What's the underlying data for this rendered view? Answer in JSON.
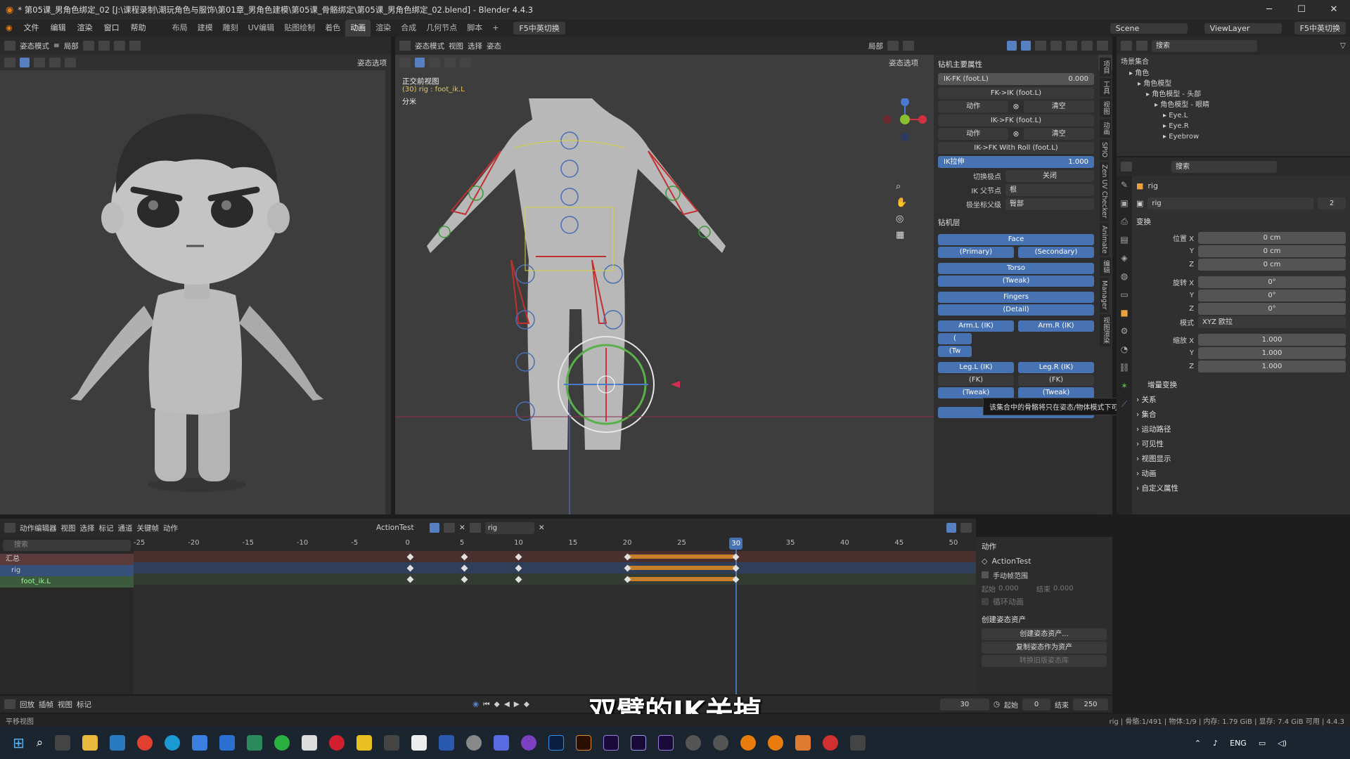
{
  "window": {
    "title": "* 第05课_男角色绑定_02 [J:\\课程录制\\潮玩角色与服饰\\第01章_男角色建模\\第05课_骨骼绑定\\第05课_男角色绑定_02.blend] - Blender 4.4.3"
  },
  "menu": {
    "items": [
      "文件",
      "编辑",
      "渲染",
      "窗口",
      "帮助"
    ],
    "workspaces": [
      "布局",
      "建模",
      "雕刻",
      "UV编辑",
      "贴图绘制",
      "着色",
      "动画",
      "渲染",
      "合成",
      "几何节点",
      "脚本"
    ],
    "active_workspace": "动画",
    "ime": "F5中英切换",
    "scene": "Scene",
    "view_layer": "ViewLayer",
    "ime2": "F5中英切换"
  },
  "left_vp": {
    "mode": "姿态模式",
    "view": "视图",
    "local": "局部",
    "pose_opts": "姿态选项"
  },
  "main_vp": {
    "mode": "姿态模式",
    "menus": [
      "视图",
      "选择",
      "姿态"
    ],
    "local": "局部",
    "pose_opts": "姿态选项",
    "overlay_title": "正交前视图",
    "overlay_sub": "(30) rig : foot_ik.L",
    "overlay_unit": "分米"
  },
  "rig_panel": {
    "main_props": "钻机主要属性",
    "ikfk_label": "IK-FK (foot.L)",
    "ikfk_value": "0.000",
    "fk_to_ik": "FK->IK (foot.L)",
    "action": "动作",
    "clear": "清空",
    "ik_to_fk": "IK->FK (foot.L)",
    "action2": "动作",
    "clear2": "清空",
    "ik_fk_roll": "IK->FK With Roll (foot.L)",
    "ik_stretch": "IK拉伸",
    "ik_stretch_value": "1.000",
    "toggle_pole": "切换极点",
    "toggle_pole_value": "关闭",
    "ik_parent": "IK 父节点",
    "ik_parent_value": "根",
    "pole_parent": "极坐标父级",
    "pole_parent_value": "臀部",
    "layers_title": "钻机层",
    "layers": {
      "face": "Face",
      "primary": "(Primary)",
      "secondary": "(Secondary)",
      "torso": "Torso",
      "tweak": "(Tweak)",
      "fingers": "Fingers",
      "detail": "(Detail)",
      "arm_l_ik": "Arm.L (IK)",
      "arm_r_ik": "Arm.R (IK)",
      "partial1": "(",
      "partial2": "(Tw",
      "leg_l_ik": "Leg.L (IK)",
      "leg_r_ik": "Leg.R (IK)",
      "fk_l": "(FK)",
      "fk_r": "(FK)",
      "tweak_l": "(Tweak)",
      "tweak_r": "(Tweak)",
      "root": "Root"
    },
    "tooltip": "该集合中的骨骼将只在姿态/物体模式下可见."
  },
  "side_tabs": [
    "项目",
    "工具",
    "视图",
    "动画",
    "SPIO",
    "Zen UV Checker",
    "Animate",
    "编辑",
    "Manager",
    "视图渲染"
  ],
  "outliner": {
    "search": "搜索",
    "root": "场景集合",
    "items": [
      {
        "label": "角色",
        "depth": 1
      },
      {
        "label": "角色模型",
        "depth": 2
      },
      {
        "label": "角色模型 - 头部",
        "depth": 3
      },
      {
        "label": "角色模型 - 眼睛",
        "depth": 4
      },
      {
        "label": "Eye.L",
        "depth": 5
      },
      {
        "label": "Eye.R",
        "depth": 5
      },
      {
        "label": "Eyebrow",
        "depth": 5
      }
    ]
  },
  "props": {
    "search": "搜索",
    "object_name": "rig",
    "data_name": "rig",
    "data_users": "2",
    "transform": "变换",
    "loc_label": "位置 X",
    "loc": [
      "0 cm",
      "0 cm",
      "0 cm"
    ],
    "rot_label": "旋转 X",
    "rot": [
      "0°",
      "0°",
      "0°"
    ],
    "mode_label": "模式",
    "mode_value": "XYZ 欧拉",
    "scale_label": "缩放 X",
    "scale": [
      "1.000",
      "1.000",
      "1.000"
    ],
    "y": "Y",
    "z": "Z",
    "delta": "增量变换",
    "sections": [
      "关系",
      "集合",
      "运动路径",
      "可见性",
      "视图显示",
      "动画",
      "自定义属性"
    ]
  },
  "action_editor": {
    "editor": "动作编辑器",
    "menus": [
      "视图",
      "选择",
      "标记",
      "通道",
      "关键帧",
      "动作"
    ],
    "action": "ActionTest",
    "slot": "rig",
    "search": "搜索",
    "channels": [
      "汇总",
      "rig",
      "foot_ik.L"
    ],
    "ticks": [
      "-25",
      "-20",
      "-15",
      "-10",
      "-5",
      "0",
      "5",
      "10",
      "15",
      "20",
      "25",
      "30",
      "35",
      "40",
      "45",
      "50"
    ],
    "current_frame": "30"
  },
  "action_side": {
    "action_title": "动作",
    "action_name": "ActionTest",
    "manual_range": "手动帧范围",
    "start": "起始",
    "start_val": "0.000",
    "end": "结束",
    "end_val": "0.000",
    "cyclic": "循环动画",
    "asset_title": "创建姿态资产",
    "create_asset": "创建姿态资产...",
    "copy_asset": "复制姿态作为资产",
    "convert": "转换旧版姿态库"
  },
  "timeline": {
    "menus": [
      "回放",
      "插帧",
      "视图",
      "标记"
    ],
    "frame": "30",
    "start_label": "起始",
    "start": "0",
    "end_label": "结束",
    "end": "250"
  },
  "subtitle": "双臂的IK关掉",
  "status": {
    "left": "平移视图",
    "right": "rig | 骨骼:1/491 | 物体:1/9 | 内存: 1.79 GiB | 显存: 7.4 GiB 可用 | 4.4.3"
  },
  "taskbar": {
    "lang": "ENG"
  },
  "colors": {
    "accent": "#4772b3",
    "keyframe_bar": "#c87f2a",
    "frame_line": "#4772b3"
  }
}
